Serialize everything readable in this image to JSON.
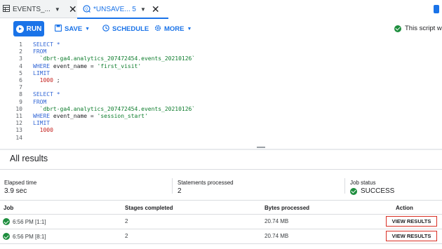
{
  "tabs": [
    {
      "label": "EVENTS_...",
      "icon": "table-icon",
      "active": false
    },
    {
      "label": "*UNSAVE... 5",
      "icon": "query-icon",
      "active": true
    }
  ],
  "toolbar": {
    "run_label": "RUN",
    "save_label": "SAVE",
    "schedule_label": "SCHEDULE",
    "more_label": "MORE",
    "status_text": "This script will"
  },
  "editor": {
    "lines": [
      {
        "n": "1",
        "tokens": [
          {
            "t": "SELECT *",
            "c": "kw"
          }
        ]
      },
      {
        "n": "2",
        "tokens": [
          {
            "t": "FROM",
            "c": "kw"
          }
        ]
      },
      {
        "n": "3",
        "tokens": [
          {
            "t": "  `dbrt-ga4.analytics_207472454.events_20210126`",
            "c": "str"
          }
        ]
      },
      {
        "n": "4",
        "tokens": [
          {
            "t": "WHERE ",
            "c": "kw"
          },
          {
            "t": "event_name = ",
            "c": "plain"
          },
          {
            "t": "'first_visit'",
            "c": "str"
          }
        ]
      },
      {
        "n": "5",
        "tokens": [
          {
            "t": "LIMIT",
            "c": "kw"
          }
        ]
      },
      {
        "n": "6",
        "tokens": [
          {
            "t": "  1000",
            "c": "num"
          },
          {
            "t": " ;",
            "c": "plain"
          }
        ]
      },
      {
        "n": "7",
        "tokens": []
      },
      {
        "n": "8",
        "tokens": [
          {
            "t": "SELECT *",
            "c": "kw"
          }
        ]
      },
      {
        "n": "9",
        "tokens": [
          {
            "t": "FROM",
            "c": "kw"
          }
        ]
      },
      {
        "n": "10",
        "tokens": [
          {
            "t": "  `dbrt-ga4.analytics_207472454.events_20210126`",
            "c": "str"
          }
        ]
      },
      {
        "n": "11",
        "tokens": [
          {
            "t": "WHERE ",
            "c": "kw"
          },
          {
            "t": "event_name = ",
            "c": "plain"
          },
          {
            "t": "'session_start'",
            "c": "str"
          }
        ]
      },
      {
        "n": "12",
        "tokens": [
          {
            "t": "LIMIT",
            "c": "kw"
          }
        ]
      },
      {
        "n": "13",
        "tokens": [
          {
            "t": "  1000",
            "c": "num"
          }
        ]
      },
      {
        "n": "14",
        "tokens": []
      }
    ]
  },
  "results": {
    "title": "All results",
    "elapsed_label": "Elapsed time",
    "elapsed_value": "3.9 sec",
    "statements_label": "Statements processed",
    "statements_value": "2",
    "status_label": "Job status",
    "status_value": "SUCCESS",
    "columns": [
      "Job",
      "Stages completed",
      "Bytes processed",
      "Action"
    ],
    "rows": [
      {
        "job": "6:56 PM [1:1]",
        "stages": "2",
        "bytes": "20.74 MB",
        "action": "VIEW RESULTS"
      },
      {
        "job": "6:56 PM [8:1]",
        "stages": "2",
        "bytes": "20.74 MB",
        "action": "VIEW RESULTS"
      }
    ]
  },
  "colors": {
    "accent": "#1a73e8",
    "success": "#1e8e3e",
    "highlight": "#d93025"
  }
}
